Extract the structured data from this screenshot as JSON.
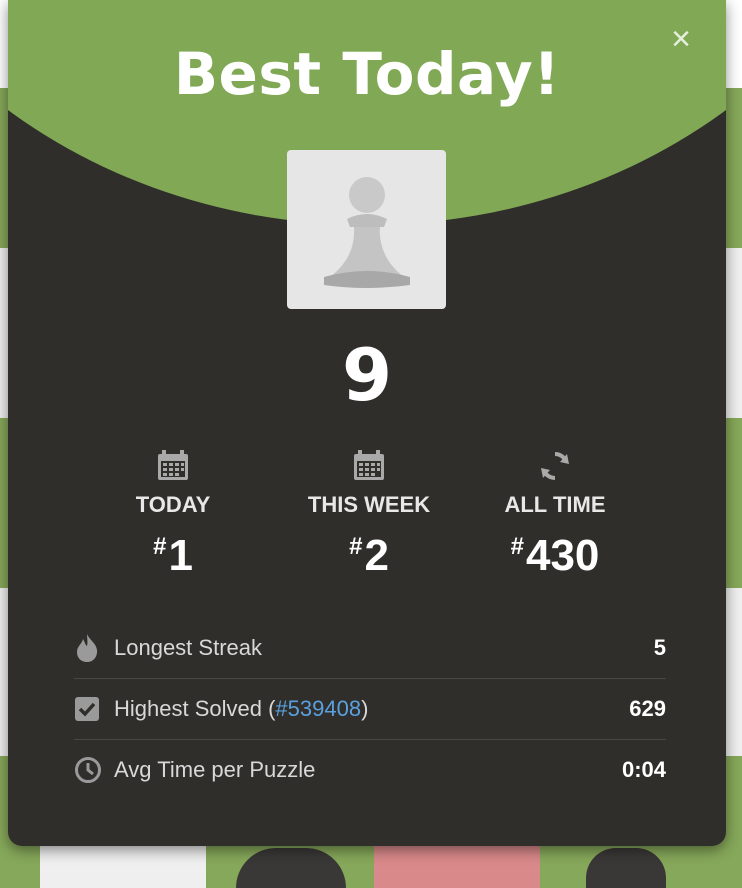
{
  "modal": {
    "title": "Best Today!",
    "close_symbol": "×",
    "score": "9",
    "piece_icon": "pawn-icon"
  },
  "stats": [
    {
      "label": "TODAY",
      "hash": "#",
      "rank": "1",
      "icon": "calendar-icon"
    },
    {
      "label": "THIS WEEK",
      "hash": "#",
      "rank": "2",
      "icon": "calendar-icon"
    },
    {
      "label": "ALL TIME",
      "hash": "#",
      "rank": "430",
      "icon": "refresh-icon"
    }
  ],
  "rows": {
    "streak": {
      "label": "Longest Streak",
      "value": "5",
      "icon": "flame-icon"
    },
    "highest": {
      "label_prefix": "Highest Solved (",
      "link": "#539408",
      "label_suffix": ")",
      "value": "629",
      "icon": "checkbox-icon"
    },
    "avg": {
      "label": "Avg Time per Puzzle",
      "value": "0:04",
      "icon": "clock-icon"
    }
  },
  "colors": {
    "header_green": "#81a955",
    "modal_bg": "#302e2b",
    "link_blue": "#5aa0de"
  }
}
